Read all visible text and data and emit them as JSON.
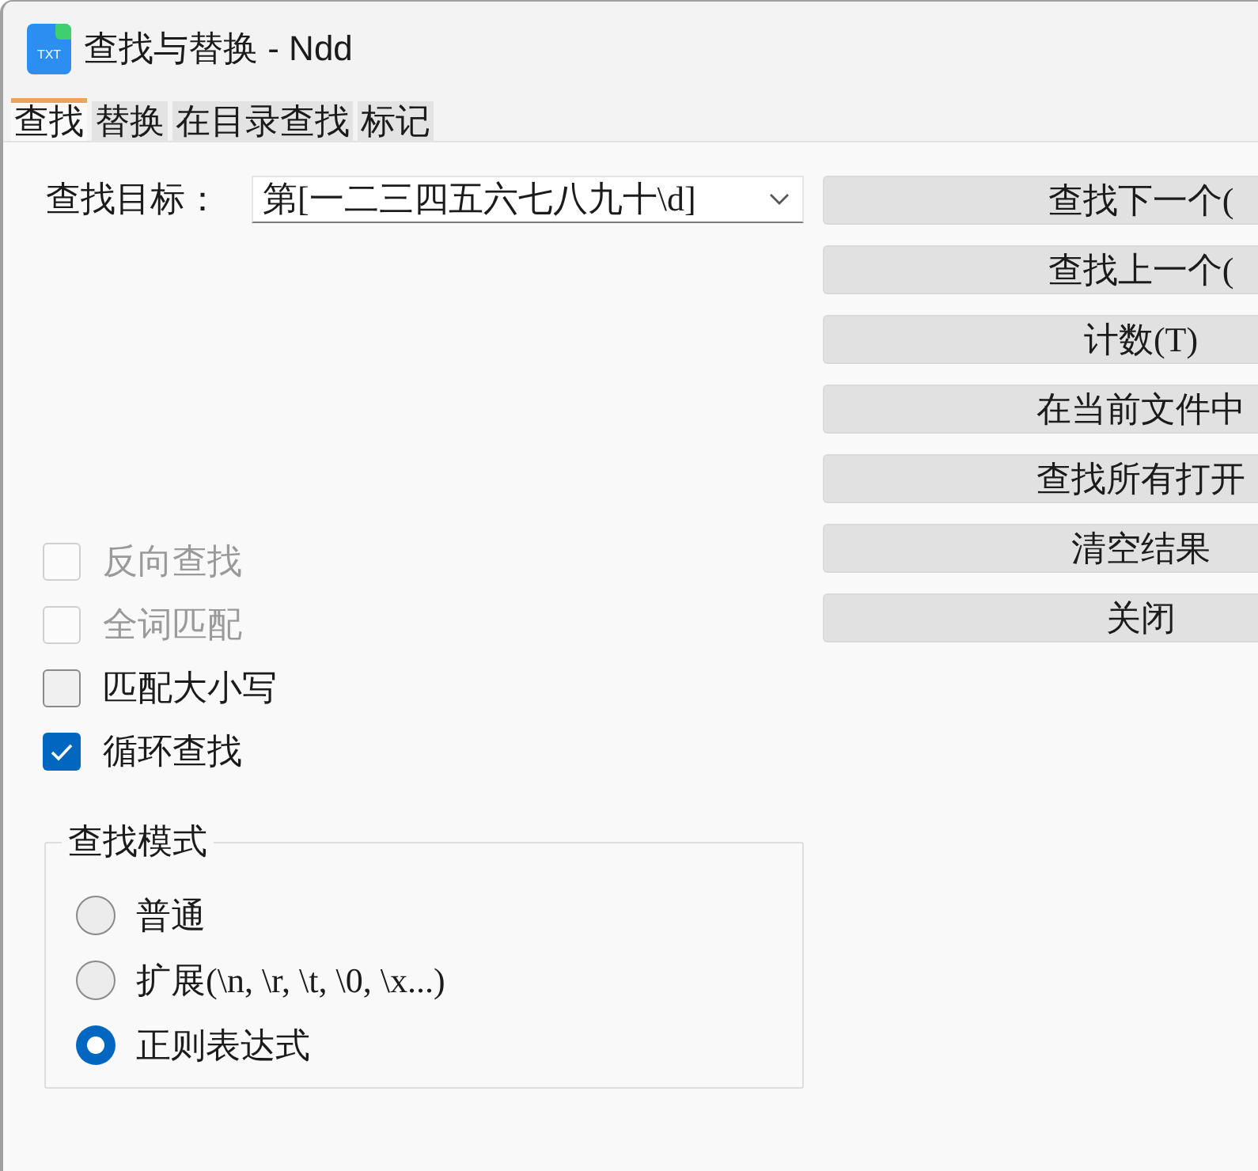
{
  "window": {
    "title": "查找与替换 - Ndd",
    "icon_label": "TXT"
  },
  "tabs": [
    {
      "label": "查找",
      "selected": true
    },
    {
      "label": "替换",
      "selected": false
    },
    {
      "label": "在目录查找",
      "selected": false
    },
    {
      "label": "标记",
      "selected": false
    }
  ],
  "find_target": {
    "label": "查找目标：",
    "value": "第[一二三四五六七八九十\\d]"
  },
  "buttons": [
    "查找下一个(",
    "查找上一个(",
    "计数(T)",
    "在当前文件中",
    "查找所有打开",
    "清空结果",
    "关闭"
  ],
  "options": [
    {
      "label": "反向查找",
      "checked": false,
      "disabled": true
    },
    {
      "label": "全词匹配",
      "checked": false,
      "disabled": true
    },
    {
      "label": "匹配大小写",
      "checked": false,
      "disabled": false
    },
    {
      "label": "循环查找",
      "checked": true,
      "disabled": false
    }
  ],
  "search_mode": {
    "title": "查找模式",
    "modes": [
      {
        "label": "普通",
        "selected": false
      },
      {
        "label": "扩展(\\n, \\r, \\t, \\0, \\x...)",
        "selected": false
      },
      {
        "label": "正则表达式",
        "selected": true
      }
    ]
  }
}
